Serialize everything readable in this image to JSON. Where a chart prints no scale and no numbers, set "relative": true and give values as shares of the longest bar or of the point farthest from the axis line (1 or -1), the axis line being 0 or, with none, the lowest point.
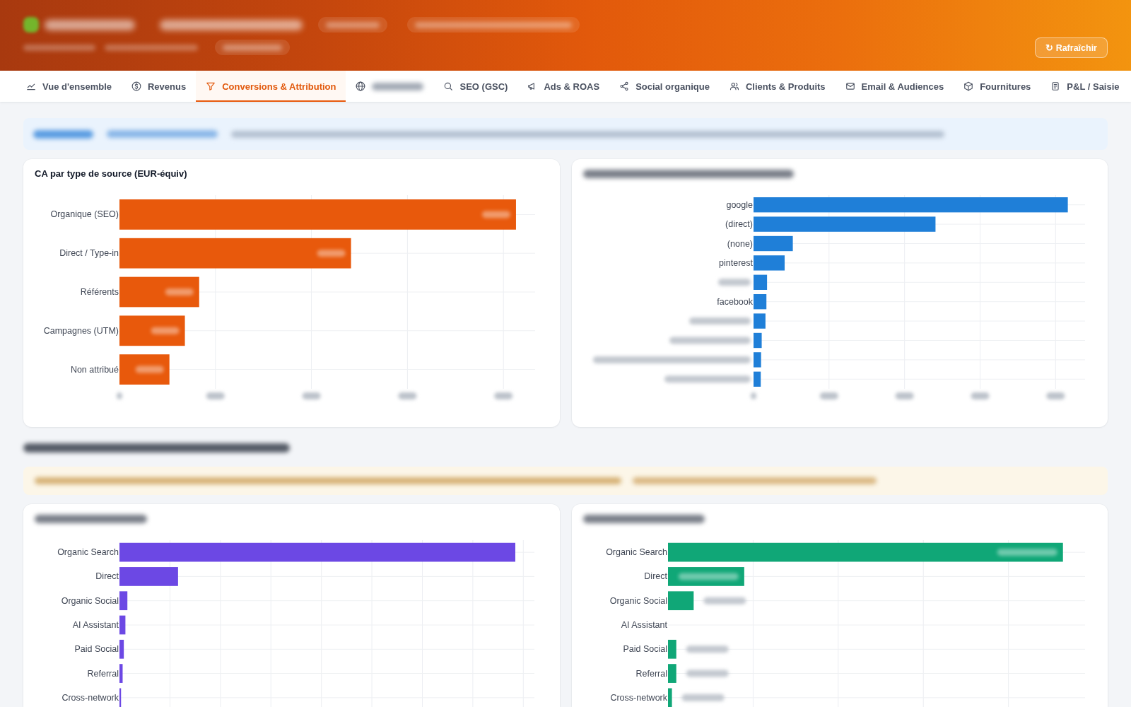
{
  "header": {
    "title": {
      "redacted": true
    },
    "badges": [
      {
        "redacted": true
      },
      {
        "redacted": true
      }
    ],
    "subtitle": {
      "redacted": true
    },
    "subtitle_badge": {
      "redacted": true
    },
    "refresh_button": "↻ Rafraîchir"
  },
  "tabs": [
    {
      "label": "Vue d'ensemble",
      "selected": false
    },
    {
      "label": "Revenus",
      "selected": false
    },
    {
      "label": "Conversions & Attribution",
      "selected": true
    },
    {
      "label": {
        "redacted": true
      },
      "selected": false
    },
    {
      "label": "SEO (GSC)",
      "selected": false
    },
    {
      "label": "Ads & ROAS",
      "selected": false
    },
    {
      "label": "Social organique",
      "selected": false
    },
    {
      "label": "Clients & Produits",
      "selected": false
    },
    {
      "label": "Email & Audiences",
      "selected": false
    },
    {
      "label": "Fournitures",
      "selected": false
    },
    {
      "label": "P&L / Saisie",
      "selected": false
    }
  ],
  "info_banner": {
    "redacted": true
  },
  "attribution_charts": [
    {
      "title": "CA par type de source (EUR-équiv)",
      "value_labels_redacted": true,
      "tick_labels_redacted": true,
      "chart_data": {
        "type": "bar",
        "orientation": "h",
        "relative": true,
        "categories": [
          "Organique (SEO)",
          "Direct / Type-in",
          "Référents",
          "Campagnes (UTM)",
          "Non attribué"
        ],
        "series": [
          {
            "color": "#e8590c",
            "values": [
              1,
              0.584,
              0.201,
              0.165,
              0.126
            ]
          }
        ]
      }
    },
    {
      "title": {
        "redacted": true
      },
      "tick_labels_redacted": true,
      "chart_data": {
        "type": "bar",
        "orientation": "h",
        "relative": true,
        "categories": [
          "google",
          "(direct)",
          "(none)",
          "pinterest",
          null,
          "facebook",
          null,
          null,
          null,
          null
        ],
        "series": [
          {
            "color": "#1f7fd8",
            "values": [
              1,
              0.579,
              0.125,
              0.099,
              0.043,
              0.041,
              0.038,
              0.026,
              0.024,
              0.023
            ]
          }
        ]
      }
    }
  ],
  "section": {
    "heading": {
      "redacted": true
    },
    "warning": {
      "redacted": true
    },
    "charts": [
      {
        "title": {
          "redacted": true
        },
        "chart_data": {
          "type": "bar",
          "orientation": "h",
          "relative": true,
          "categories": [
            "Organic Search",
            "Direct",
            "Organic Social",
            "AI Assistant",
            "Paid Social",
            "Referral",
            "Cross-network"
          ],
          "series": [
            {
              "color": "#6c48e4",
              "values": [
                1,
                0.148,
                0.02,
                0.015,
                0.011,
                0.008,
                0.004
              ]
            }
          ]
        }
      },
      {
        "title": {
          "redacted": true
        },
        "value_labels_redacted": true,
        "chart_data": {
          "type": "bar",
          "orientation": "h",
          "relative": true,
          "categories": [
            "Organic Search",
            "Direct",
            "Organic Social",
            "AI Assistant",
            "Paid Social",
            "Referral",
            "Cross-network"
          ],
          "series": [
            {
              "color": "#10a777",
              "values": [
                1,
                0.193,
                0.065,
                0,
                0.021,
                0.021,
                0.01
              ]
            }
          ]
        }
      }
    ]
  }
}
